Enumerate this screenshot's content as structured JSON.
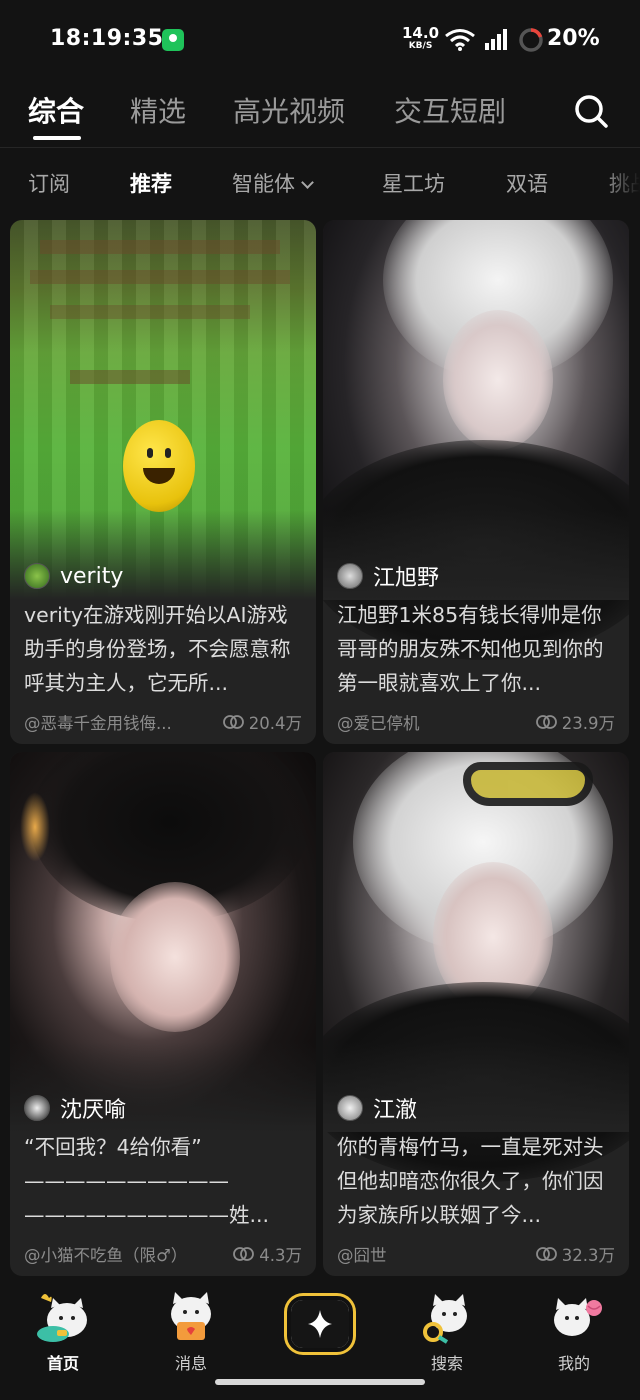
{
  "status_bar": {
    "time": "18:19:35",
    "net_speed_value": "14.0",
    "net_speed_unit": "KB/S",
    "battery_percent": "20%"
  },
  "main_tabs": [
    {
      "label": "综合",
      "active": true
    },
    {
      "label": "精选",
      "active": false
    },
    {
      "label": "高光视频",
      "active": false
    },
    {
      "label": "交互短剧",
      "active": false
    }
  ],
  "sub_tabs": [
    {
      "label": "订阅",
      "active": false
    },
    {
      "label": "推荐",
      "active": true
    },
    {
      "label": "智能体",
      "active": false
    },
    {
      "label": "星工坊",
      "active": false
    },
    {
      "label": "双语",
      "active": false
    },
    {
      "label": "挑战",
      "active": false
    }
  ],
  "cards": [
    {
      "name": "verity",
      "description": "verity在游戏刚开始以AI游戏助手的身份登场，不会愿意称呼其为主人，它无所...",
      "creator": "@恶毒千金用钱侮...",
      "count": "20.4万"
    },
    {
      "name": "江旭野",
      "description": "江旭野1米85有钱长得帅是你哥哥的朋友殊不知他见到你的第一眼就喜欢上了你...",
      "creator": "@爱已停机",
      "count": "23.9万"
    },
    {
      "name": "沈厌喻",
      "description": "“不回我？4给你看”\n——————————\n——————————姓...",
      "creator": "@小猫不吃鱼（限♂）",
      "count": "4.3万"
    },
    {
      "name": "江澈",
      "description": "你的青梅竹马，一直是死对头但他却暗恋你很久了，你们因为家族所以联姻了今...",
      "creator": "@囧世",
      "count": "32.3万"
    }
  ],
  "bottom_nav": [
    {
      "label": "首页",
      "active": true,
      "icon": "cat-home-icon"
    },
    {
      "label": "消息",
      "active": false,
      "icon": "cat-message-icon"
    },
    {
      "label": "",
      "active": false,
      "icon": "create-sparkle-icon"
    },
    {
      "label": "搜索",
      "active": false,
      "icon": "cat-search-icon"
    },
    {
      "label": "我的",
      "active": false,
      "icon": "cat-profile-icon"
    }
  ],
  "colors": {
    "background": "#131313",
    "card_background": "#232323",
    "accent_yellow": "#f0c23a",
    "battery_ring": "#e8453c"
  }
}
